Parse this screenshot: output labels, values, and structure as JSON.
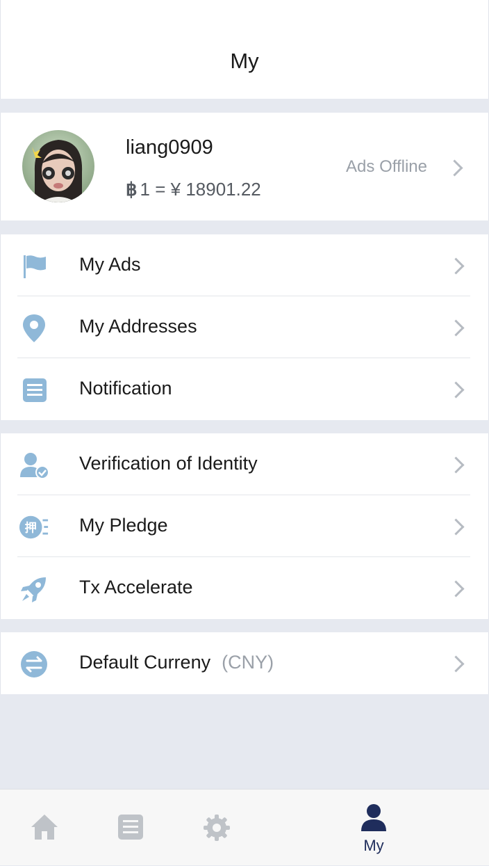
{
  "header": {
    "title": "My"
  },
  "profile": {
    "username": "liang0909",
    "rate_text": "1 = ¥ 18901.22",
    "btc_symbol": "฿",
    "ads_status": "Ads Offline"
  },
  "menu_group_1": [
    {
      "label": "My Ads",
      "icon": "flag-icon"
    },
    {
      "label": "My Addresses",
      "icon": "location-pin-icon"
    },
    {
      "label": "Notification",
      "icon": "document-list-icon"
    }
  ],
  "menu_group_2": [
    {
      "label": "Verification of Identity",
      "icon": "user-verified-icon"
    },
    {
      "label": "My Pledge",
      "icon": "pledge-icon",
      "icon_text": "押"
    },
    {
      "label": "Tx Accelerate",
      "icon": "rocket-icon"
    }
  ],
  "menu_group_3": [
    {
      "label": "Default Curreny",
      "sub": "(CNY)",
      "icon": "exchange-icon"
    }
  ],
  "tabbar": {
    "tabs": [
      {
        "icon": "home-icon",
        "label": ""
      },
      {
        "icon": "list-icon",
        "label": ""
      },
      {
        "icon": "gear-icon",
        "label": ""
      },
      {
        "icon": "user-icon",
        "label": "My"
      }
    ]
  },
  "colors": {
    "icon_blue": "#8fb8d8",
    "active_tab": "#1f2d5c",
    "inactive_tab": "#bfc3c8",
    "background": "#e6e9f0"
  }
}
